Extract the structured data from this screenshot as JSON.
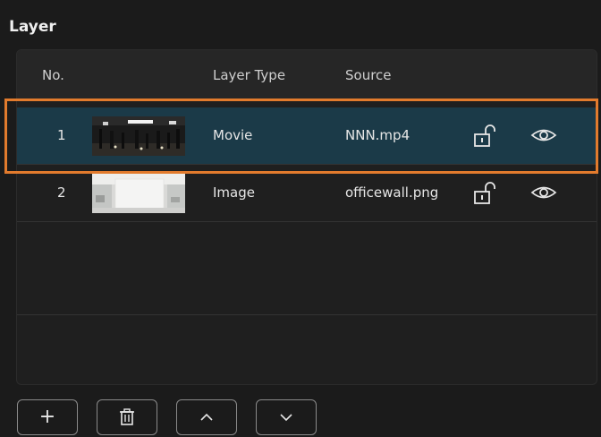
{
  "panel": {
    "title": "Layer"
  },
  "table": {
    "columns": {
      "no": "No.",
      "layer_type": "Layer Type",
      "source": "Source"
    },
    "rows": [
      {
        "no": "1",
        "layer_type": "Movie",
        "source": "NNN.mp4",
        "thumbnail": "dark-studio-scene",
        "lock_icon": "unlock-icon",
        "visibility_icon": "eye-icon",
        "selected": true
      },
      {
        "no": "2",
        "layer_type": "Image",
        "source": "officewall.png",
        "thumbnail": "white-office-wall",
        "lock_icon": "unlock-icon",
        "visibility_icon": "eye-icon",
        "selected": false
      }
    ]
  },
  "toolbar": {
    "add_label": "+",
    "delete_icon": "trash-icon",
    "up_icon": "chevron-up-icon",
    "down_icon": "chevron-down-icon"
  },
  "colors": {
    "selected_row": "#1b3a48",
    "selection_outline": "#e27b2d",
    "panel_bg": "#1b1b1b"
  }
}
